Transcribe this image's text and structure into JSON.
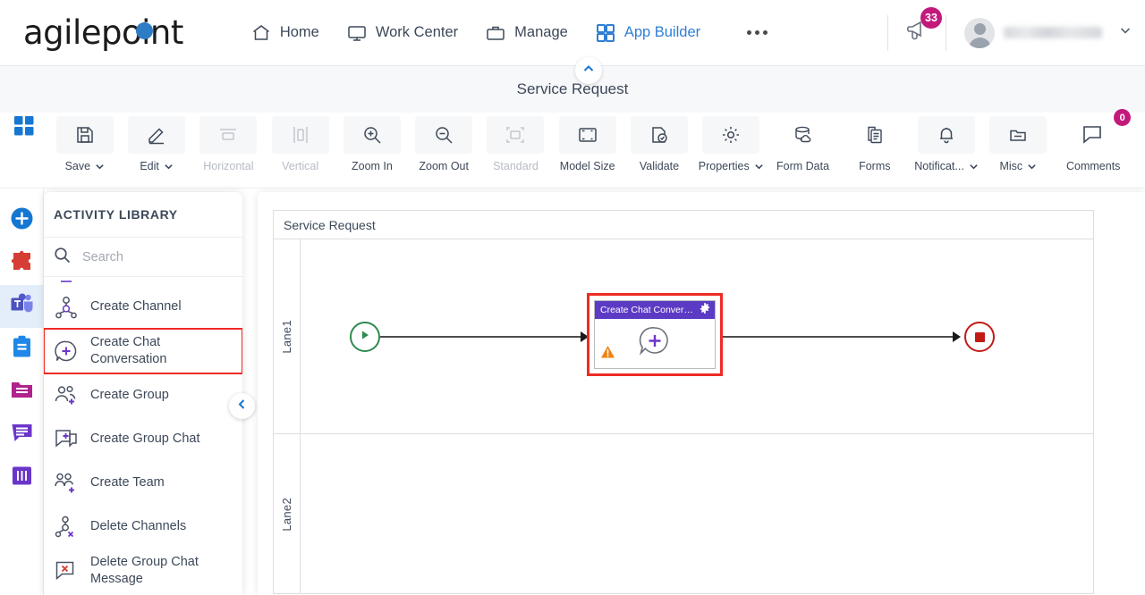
{
  "brand": {
    "name": "agilepoint",
    "accent": "#2e7cc4"
  },
  "topnav": {
    "items": [
      {
        "label": "Home",
        "icon": "home-icon",
        "active": false
      },
      {
        "label": "Work Center",
        "icon": "monitor-icon",
        "active": false
      },
      {
        "label": "Manage",
        "icon": "briefcase-icon",
        "active": false
      },
      {
        "label": "App Builder",
        "icon": "grid-icon",
        "active": true
      }
    ],
    "overflow_label": "...",
    "announcements": {
      "icon": "megaphone-icon",
      "badge": "33",
      "badge_color": "#c2197b"
    },
    "user": {
      "name": "",
      "avatar": "user-avatar",
      "chevron": "chevron-down-icon"
    }
  },
  "page": {
    "title": "Service Request",
    "collapse_icon": "chevron-up-icon"
  },
  "toolbar": {
    "apps_icon": "apps-grid-icon",
    "buttons": [
      {
        "label": "Save",
        "icon": "save-icon",
        "dropdown": true,
        "disabled": false
      },
      {
        "label": "Edit",
        "icon": "pencil-icon",
        "dropdown": true,
        "disabled": false
      },
      {
        "label": "Horizontal",
        "icon": "horizontal-align-icon",
        "dropdown": false,
        "disabled": true
      },
      {
        "label": "Vertical",
        "icon": "vertical-align-icon",
        "dropdown": false,
        "disabled": true
      },
      {
        "label": "Zoom In",
        "icon": "zoom-in-icon",
        "dropdown": false,
        "disabled": false
      },
      {
        "label": "Zoom Out",
        "icon": "zoom-out-icon",
        "dropdown": false,
        "disabled": false
      },
      {
        "label": "Standard",
        "icon": "standard-size-icon",
        "dropdown": false,
        "disabled": true
      },
      {
        "label": "Model Size",
        "icon": "model-size-icon",
        "dropdown": false,
        "disabled": false
      },
      {
        "label": "Validate",
        "icon": "validate-icon",
        "dropdown": false,
        "disabled": false
      },
      {
        "label": "Properties",
        "icon": "gear-icon",
        "dropdown": true,
        "disabled": false
      },
      {
        "label": "Form Data",
        "icon": "database-cloud-icon",
        "dropdown": false,
        "disabled": false
      },
      {
        "label": "Forms",
        "icon": "documents-icon",
        "dropdown": false,
        "disabled": false
      },
      {
        "label": "Notificat...",
        "icon": "bell-icon",
        "dropdown": true,
        "disabled": false
      },
      {
        "label": "Misc",
        "icon": "folder-icon",
        "dropdown": true,
        "disabled": false
      }
    ],
    "comments": {
      "label": "Comments",
      "icon": "comment-icon",
      "badge": "0",
      "badge_color": "#c2197b"
    }
  },
  "rail": {
    "items": [
      {
        "name": "add-activity",
        "icon": "plus-circle-icon",
        "color": "#1677d2",
        "selected": false
      },
      {
        "name": "integrations",
        "icon": "puzzle-icon",
        "color": "#d63e34",
        "selected": false
      },
      {
        "name": "microsoft-teams",
        "icon": "teams-icon",
        "color": "#5059c9",
        "selected": true
      },
      {
        "name": "tasks",
        "icon": "clipboard-icon",
        "color": "#1f87e8",
        "selected": false
      },
      {
        "name": "documents",
        "icon": "folder-icon",
        "color": "#b0228c",
        "selected": false
      },
      {
        "name": "messages",
        "icon": "chat-icon",
        "color": "#6b35c9",
        "selected": false
      },
      {
        "name": "swimlanes",
        "icon": "columns-icon",
        "color": "#6b35c9",
        "selected": false
      }
    ]
  },
  "activity_library": {
    "title": "ACTIVITY LIBRARY",
    "search": {
      "placeholder": "Search",
      "value": "",
      "icon": "search-icon"
    },
    "collapse_icon": "chevron-left-icon",
    "items": [
      {
        "label": "",
        "icon": "partial-item-icon",
        "selected": false,
        "partial": true
      },
      {
        "label": "Create Channel",
        "icon": "channel-node-icon",
        "selected": false,
        "partial": false
      },
      {
        "label": "Create Chat Conversation",
        "icon": "chat-plus-icon",
        "selected": true,
        "partial": false
      },
      {
        "label": "Create Group",
        "icon": "group-plus-icon",
        "selected": false,
        "partial": false
      },
      {
        "label": "Create Group Chat",
        "icon": "group-chat-plus-icon",
        "selected": false,
        "partial": false
      },
      {
        "label": "Create Team",
        "icon": "team-plus-icon",
        "selected": false,
        "partial": false
      },
      {
        "label": "Delete Channels",
        "icon": "channel-delete-icon",
        "selected": false,
        "partial": false
      },
      {
        "label": "Delete Group Chat Message",
        "icon": "chat-delete-icon",
        "selected": false,
        "partial": false
      }
    ]
  },
  "canvas": {
    "pool_title": "Service Request",
    "lanes": [
      {
        "label": "Lane1"
      },
      {
        "label": "Lane2"
      }
    ],
    "start_event": {
      "name": "start-event",
      "icon": "play-icon",
      "color": "#2e8b4f"
    },
    "end_event": {
      "name": "end-event",
      "icon": "stop-icon",
      "color": "#c21b17"
    },
    "activity": {
      "title": "Create Chat Conversa...",
      "header_color": "#5b3bc4",
      "gear_icon": "gear-icon",
      "warning_icon": "warning-icon",
      "glyph_icon": "chat-plus-icon",
      "selected": true,
      "selection_color": "#ee2b24"
    }
  }
}
